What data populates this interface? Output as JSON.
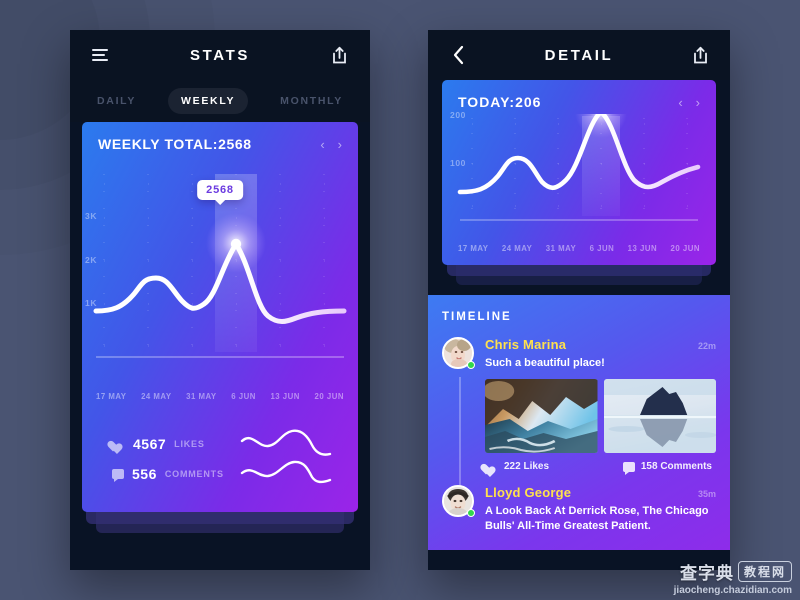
{
  "background": {
    "color": "#4A5472"
  },
  "left_phone": {
    "navbar": {
      "menu_icon": "hamburger-icon",
      "title": "STATS",
      "share_icon": "share-icon"
    },
    "tabs": [
      {
        "label": "DAILY",
        "active": false
      },
      {
        "label": "WEEKLY",
        "active": true
      },
      {
        "label": "MONTHLY",
        "active": false
      }
    ],
    "chart_card": {
      "title": "WEEKLY TOTAL:2568",
      "prev_arrow": "chevron-left-icon",
      "next_arrow": "chevron-right-icon",
      "tooltip_value": "2568"
    },
    "footer": {
      "likes_value": "4567",
      "likes_label": "LIKES",
      "comments_value": "556",
      "comments_label": "COMMENTS"
    }
  },
  "right_phone": {
    "navbar": {
      "back_icon": "chevron-left-icon",
      "title": "DETAIL",
      "share_icon": "share-icon"
    },
    "chart_card": {
      "title": "TODAY:206",
      "prev_arrow": "chevron-left-icon",
      "next_arrow": "chevron-right-icon"
    },
    "timeline": {
      "heading": "TIMELINE",
      "posts": [
        {
          "name": "Chris Marina",
          "time": "22m",
          "text": "Such a beautiful place!",
          "online": true,
          "photos": [
            "coastal-seascape-photo",
            "iceberg-reflection-photo"
          ],
          "likes": "222 Likes",
          "comments": "158 Comments"
        },
        {
          "name": "Lloyd George",
          "time": "35m",
          "text": "A Look Back At Derrick Rose, The Chicago Bulls' All-Time Greatest Patient.",
          "online": true,
          "photos": [],
          "likes": "",
          "comments": ""
        }
      ]
    }
  },
  "watermark": {
    "cn": "查字典",
    "box": "教程网",
    "url": "jiaocheng.chazidian.com"
  },
  "chart_data": [
    {
      "id": "weekly-chart",
      "type": "line",
      "title": "WEEKLY TOTAL:2568",
      "categories": [
        "17 MAY",
        "24 MAY",
        "31 MAY",
        "6 JUN",
        "13 JUN",
        "20 JUN"
      ],
      "x": [
        0,
        1,
        2,
        3,
        4,
        5
      ],
      "values": [
        1000,
        1450,
        1100,
        2568,
        1350,
        1420
      ],
      "ytick_labels": [
        "1K",
        "2K",
        "3K"
      ],
      "ytick_values": [
        1000,
        2000,
        3000
      ],
      "ylim": [
        0,
        3400
      ],
      "highlight_index": 3,
      "highlight_value": 2568,
      "tooltip": "2568",
      "grid": "dotted",
      "legend": "none",
      "xlabel": "",
      "ylabel": ""
    },
    {
      "id": "detail-chart",
      "type": "line",
      "title": "TODAY:206",
      "categories": [
        "17 MAY",
        "24 MAY",
        "31 MAY",
        "6 JUN",
        "13 JUN",
        "20 JUN"
      ],
      "x": [
        0,
        1,
        2,
        3,
        4,
        5
      ],
      "values": [
        60,
        115,
        80,
        206,
        95,
        105
      ],
      "ytick_labels": [
        "100",
        "200"
      ],
      "ytick_values": [
        100,
        200
      ],
      "ylim": [
        0,
        245
      ],
      "highlight_index": 3,
      "highlight_value": 206,
      "grid": "dotted",
      "legend": "none",
      "xlabel": "",
      "ylabel": ""
    }
  ]
}
